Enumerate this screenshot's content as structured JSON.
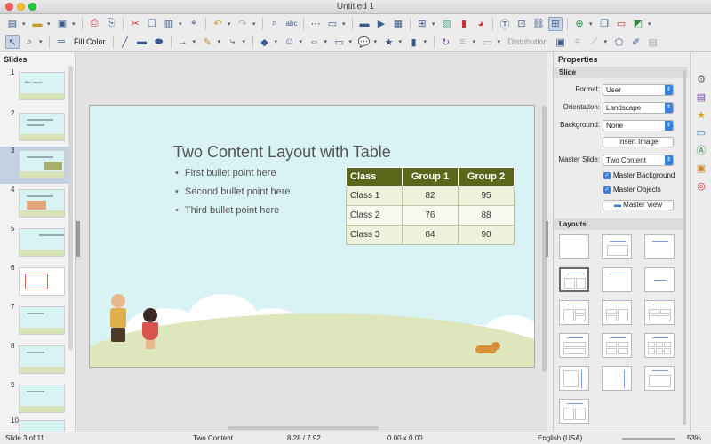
{
  "window": {
    "title": "Untitled 1"
  },
  "toolbar2": {
    "fill_label": "Fill Color",
    "distribution_label": "Distribution"
  },
  "slides_pane": {
    "title": "Slides",
    "numbers": [
      "1",
      "2",
      "3",
      "4",
      "5",
      "6",
      "7",
      "8",
      "9",
      "10"
    ],
    "thumb1_text": "Title Layout",
    "selected": "3"
  },
  "slide": {
    "title": "Two Content Layout with Table",
    "bullets": [
      "First bullet point here",
      "Second bullet point here",
      "Third bullet point here"
    ],
    "table": {
      "headers": [
        "Class",
        "Group 1",
        "Group 2"
      ],
      "rows": [
        [
          "Class 1",
          "82",
          "95"
        ],
        [
          "Class 2",
          "76",
          "88"
        ],
        [
          "Class 3",
          "84",
          "90"
        ]
      ]
    }
  },
  "properties": {
    "title": "Properties",
    "slide_section": "Slide",
    "format_label": "Format:",
    "format_value": "User",
    "orientation_label": "Orientation:",
    "orientation_value": "Landscape",
    "background_label": "Background:",
    "background_value": "None",
    "insert_image": "Insert Image",
    "master_slide_label": "Master Slide:",
    "master_slide_value": "Two Content",
    "master_background": "Master Background",
    "master_objects": "Master Objects",
    "master_view": "Master View",
    "layouts_section": "Layouts"
  },
  "status": {
    "slide": "Slide 3 of 11",
    "master": "Two Content",
    "position": "8.28 / 7.92",
    "size": "0.00 x 0.00",
    "language": "English (USA)",
    "zoom": "53%"
  },
  "colors": {
    "table_header": "#5a6619",
    "slide_bg": "#d9f3f4",
    "accent": "#3b7fd9"
  }
}
